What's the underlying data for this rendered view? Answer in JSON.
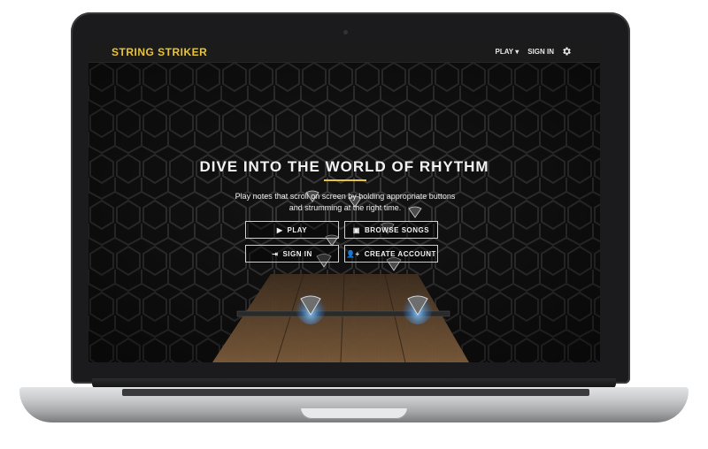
{
  "app": {
    "brand": "STRING STRIKER",
    "nav": {
      "play": "PLAY ▾",
      "sign_in": "SIGN IN"
    },
    "hero": {
      "title": "DIVE INTO THE WORLD OF RHYTHM",
      "subtitle_line1": "Play notes that scroll on screen by holding appropriate buttons",
      "subtitle_line2": "and strumming at the right time."
    },
    "buttons": {
      "play": "PLAY",
      "browse": "BROWSE SONGS",
      "sign_in": "SIGN IN",
      "create": "CREATE ACCOUNT"
    },
    "icons": {
      "play": "play-icon",
      "browse": "music-library-icon",
      "sign_in": "login-icon",
      "create": "add-user-icon",
      "settings": "gear-icon"
    }
  },
  "colors": {
    "accent": "#e7c43a",
    "navbar": "#1b1b1b",
    "background": "#121212",
    "highway": "#6b4f33",
    "note_glow": "#4aa3ff"
  }
}
